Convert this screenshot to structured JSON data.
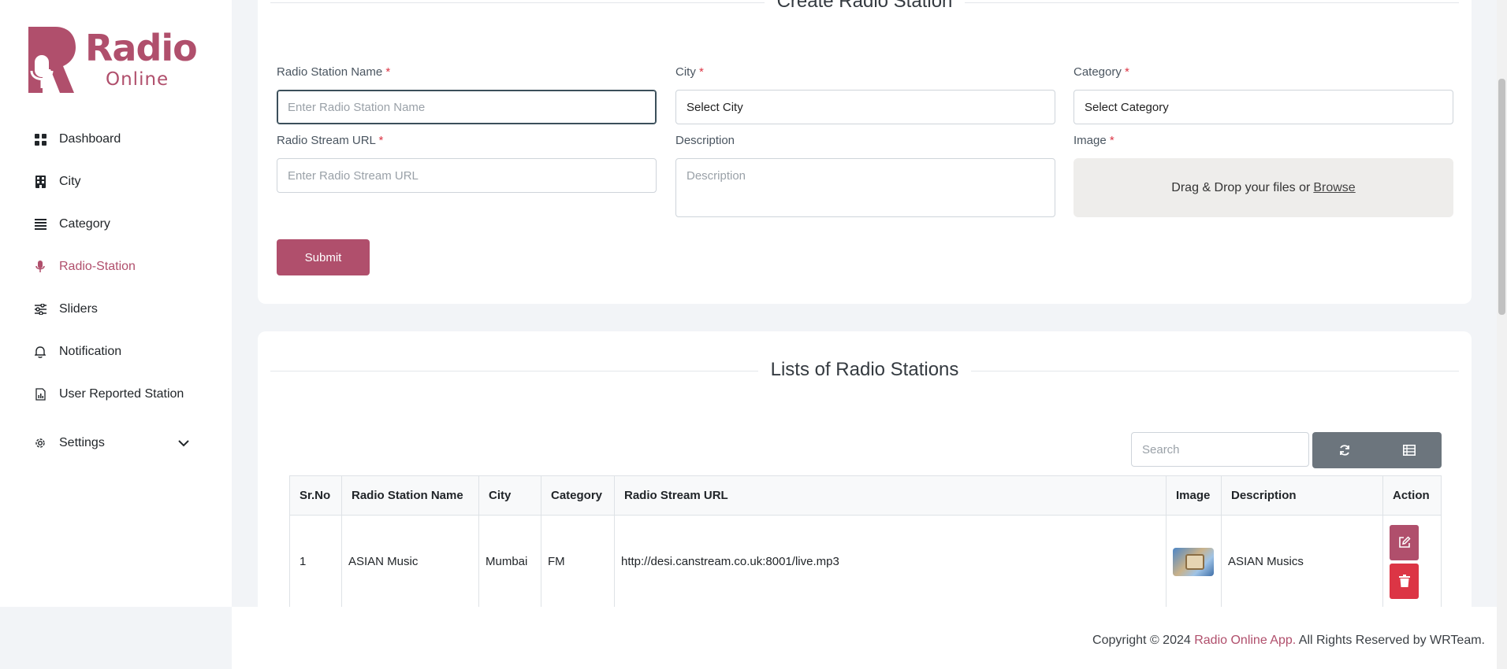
{
  "brand": {
    "name": "Radio",
    "sub": "Online",
    "color": "#b04f6c"
  },
  "sidebar": {
    "items": [
      {
        "label": "Dashboard",
        "icon": "grid-icon"
      },
      {
        "label": "City",
        "icon": "building-icon"
      },
      {
        "label": "Category",
        "icon": "list-icon"
      },
      {
        "label": "Radio-Station",
        "icon": "mic-icon",
        "active": true
      },
      {
        "label": "Sliders",
        "icon": "sliders-icon"
      },
      {
        "label": "Notification",
        "icon": "bell-icon"
      },
      {
        "label": "User Reported Station",
        "icon": "report-icon"
      },
      {
        "label": "Settings",
        "icon": "gear-icon"
      }
    ]
  },
  "form": {
    "title": "Create Radio Station",
    "name_label": "Radio Station Name",
    "name_placeholder": "Enter Radio Station Name",
    "city_label": "City",
    "city_value": "Select City",
    "category_label": "Category",
    "category_value": "Select Category",
    "url_label": "Radio Stream URL",
    "url_placeholder": "Enter Radio Stream URL",
    "desc_label": "Description",
    "desc_placeholder": "Description",
    "image_label": "Image",
    "dropzone_text": "Drag & Drop your files or",
    "dropzone_link": "Browse",
    "required_mark": "*",
    "submit": "Submit"
  },
  "list": {
    "title": "Lists of Radio Stations",
    "search_placeholder": "Search",
    "columns": [
      "Sr.No",
      "Radio Station Name",
      "City",
      "Category",
      "Radio Stream URL",
      "Image",
      "Description",
      "Action"
    ],
    "rows": [
      {
        "sr": "1",
        "name": "ASIAN Music",
        "city": "Mumbai",
        "category": "FM",
        "url": "http://desi.canstream.co.uk:8001/live.mp3",
        "description": "ASIAN Musics"
      }
    ]
  },
  "footer": {
    "prefix": "Copyright © 2024",
    "app": "Radio Online App.",
    "suffix": "All Rights Reserved by WRTeam."
  }
}
